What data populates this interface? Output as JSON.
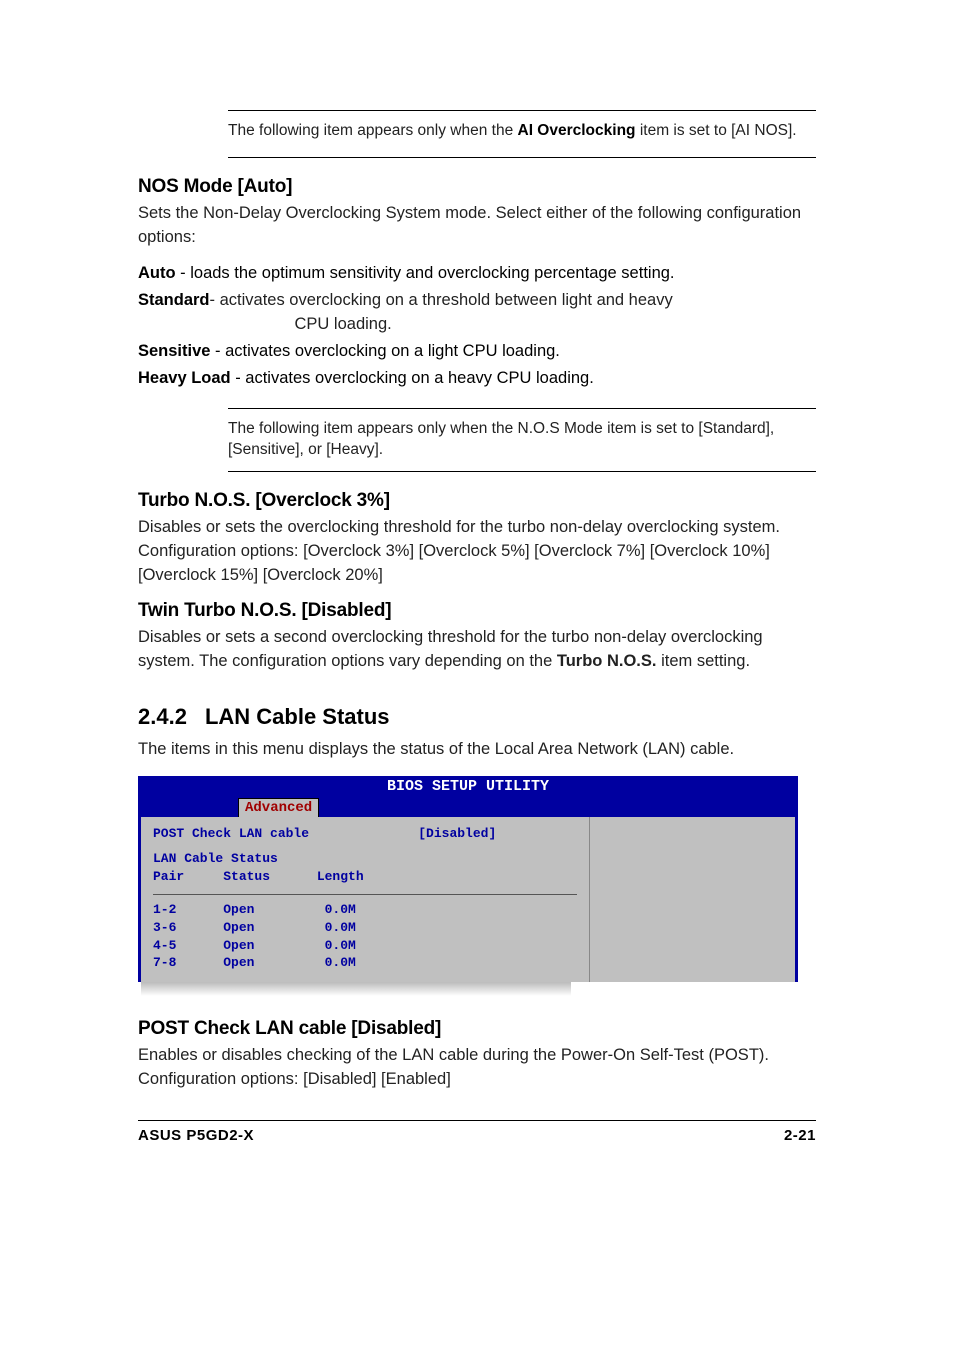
{
  "note1": {
    "pre": "The following item appears only when the ",
    "bold": "AI Overclocking",
    "post": " item is set to [AI NOS]."
  },
  "nos_mode": {
    "heading": "NOS Mode [Auto]",
    "desc": "Sets the Non-Delay Overclocking System mode. Select either of the following configuration options:",
    "opts": [
      {
        "label": "Auto",
        "desc": " - loads the optimum sensitivity and overclocking percentage setting."
      },
      {
        "label": "Standard",
        "desc": " - activates overclocking on a threshold between light and heavy CPU loading."
      },
      {
        "label": "Sensitive",
        "desc": " - activates overclocking on a light CPU loading."
      },
      {
        "label": "Heavy Load",
        "desc": " - activates overclocking on a heavy CPU loading."
      }
    ]
  },
  "note2": {
    "text": "The following item appears only when the N.O.S Mode item is set to [Standard], [Sensitive], or [Heavy]."
  },
  "turbo": {
    "heading": "Turbo N.O.S. [Overclock 3%]",
    "desc": "Disables or sets the overclocking threshold for the turbo non-delay overclocking system. Configuration options: [Overclock 3%] [Overclock 5%] [Overclock 7%] [Overclock 10%] [Overclock 15%] [Overclock 20%]"
  },
  "twin": {
    "heading": "Twin Turbo N.O.S. [Disabled]",
    "desc_pre": "Disables or sets a second overclocking threshold for the turbo non-delay overclocking system. The configuration options vary depending on the ",
    "desc_bold": "Turbo N.O.S.",
    "desc_post": " item setting."
  },
  "section": {
    "num": "2.4.2",
    "title": "LAN Cable Status",
    "desc": "The items in this menu displays the status of the Local Area Network (LAN) cable."
  },
  "bios": {
    "title": "BIOS SETUP UTILITY",
    "tab": "Advanced",
    "line1": "POST Check LAN cable              [Disabled]",
    "heading": "LAN Cable Status",
    "cols": "Pair     Status      Length",
    "rows": [
      "1-2      Open         0.0M",
      "3-6      Open         0.0M",
      "4-5      Open         0.0M",
      "7-8      Open         0.0M"
    ]
  },
  "post_check": {
    "heading": "POST Check LAN cable [Disabled]",
    "desc": "Enables or disables checking of the LAN cable during the Power-On Self-Test (POST). Configuration options: [Disabled] [Enabled]"
  },
  "footer": {
    "left": "ASUS P5GD2-X",
    "right": "2-21"
  },
  "chart_data": {
    "type": "table",
    "title": "LAN Cable Status",
    "columns": [
      "Pair",
      "Status",
      "Length"
    ],
    "rows": [
      [
        "1-2",
        "Open",
        "0.0M"
      ],
      [
        "3-6",
        "Open",
        "0.0M"
      ],
      [
        "4-5",
        "Open",
        "0.0M"
      ],
      [
        "7-8",
        "Open",
        "0.0M"
      ]
    ],
    "setting": {
      "name": "POST Check LAN cable",
      "value": "Disabled"
    }
  }
}
